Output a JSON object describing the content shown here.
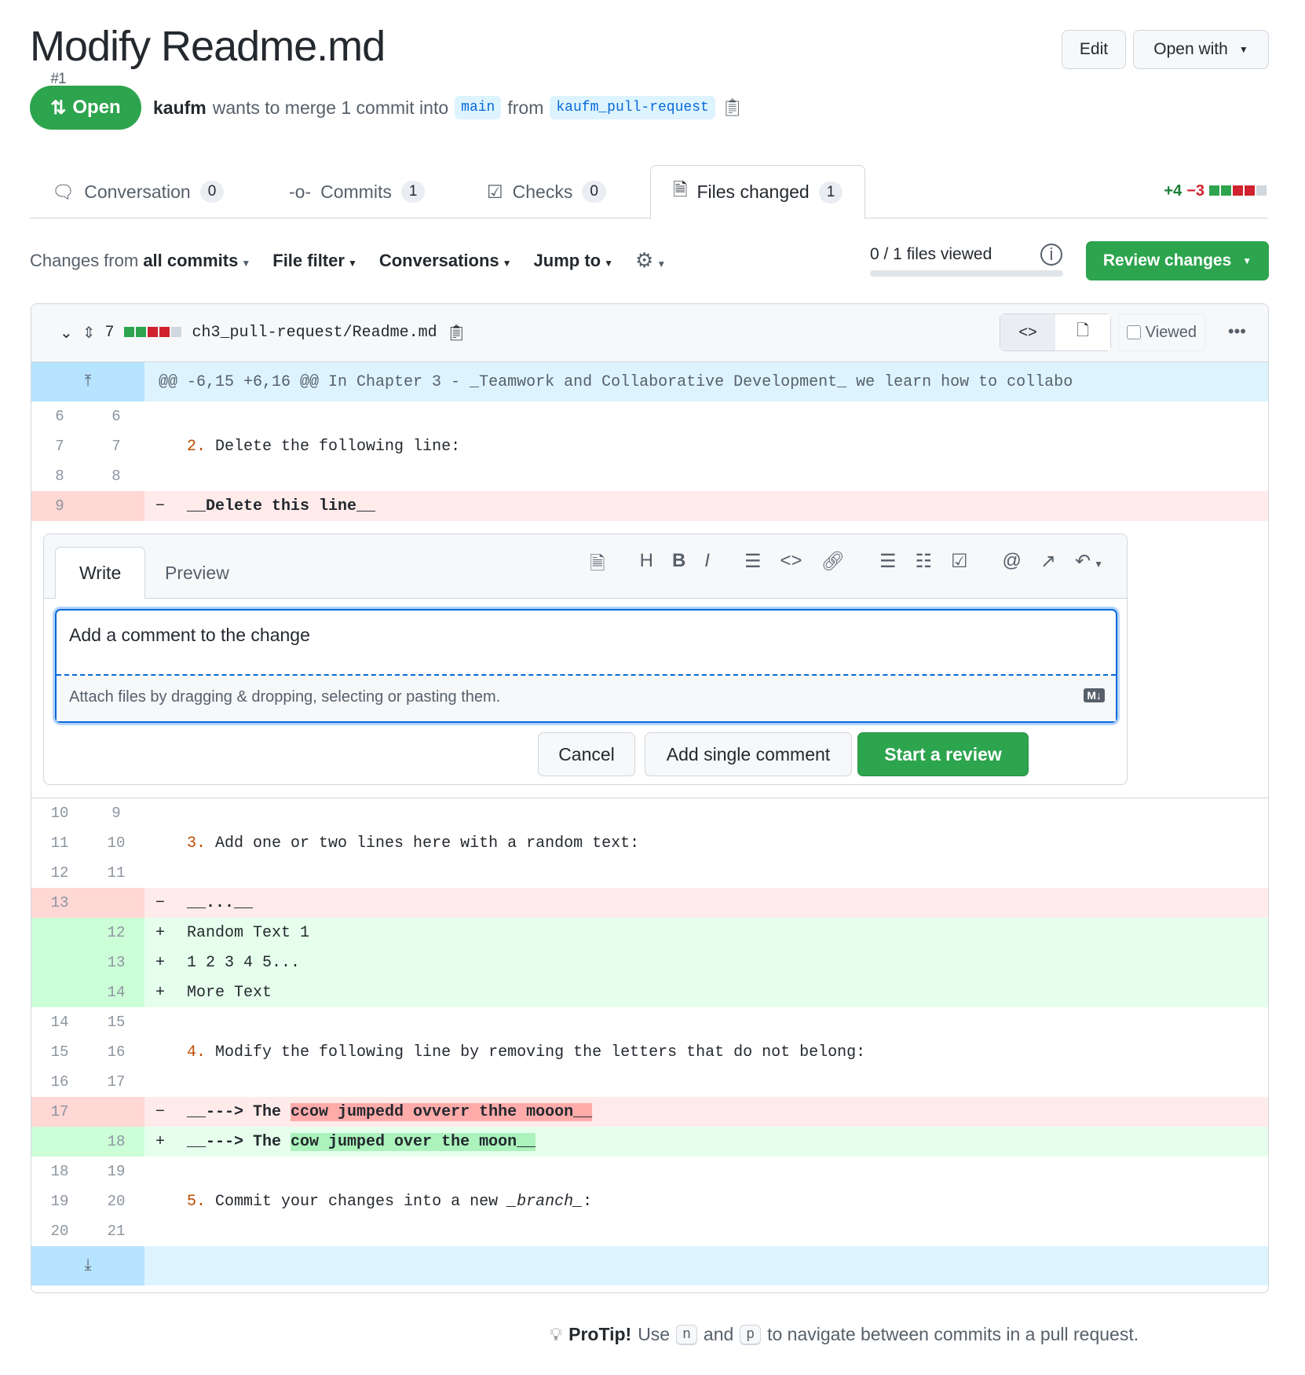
{
  "header": {
    "title": "Modify Readme.md",
    "number": "#1",
    "edit_label": "Edit",
    "open_with_label": "Open with"
  },
  "status": {
    "label": "Open",
    "author": "kaufm",
    "text_merge": "wants to merge 1 commit into",
    "base": "main",
    "text_from": "from",
    "head": "kaufm_pull-request"
  },
  "tabs": [
    {
      "label": "Conversation",
      "count": "0"
    },
    {
      "label": "Commits",
      "count": "1"
    },
    {
      "label": "Checks",
      "count": "0"
    },
    {
      "label": "Files changed",
      "count": "1"
    }
  ],
  "diffstat": {
    "additions": "+4",
    "deletions": "−3"
  },
  "toolbar": {
    "changes_prefix": "Changes from",
    "changes_value": "all commits",
    "file_filter": "File filter",
    "conversations": "Conversations",
    "jump_to": "Jump to",
    "files_viewed": "0 / 1 files viewed",
    "files_viewed_progress": 0,
    "review_changes": "Review changes"
  },
  "file": {
    "change_count": "7",
    "path": "ch3_pull-request/Readme.md",
    "viewed_label": "Viewed",
    "viewed": false
  },
  "hunk": "@@ -6,15 +6,16 @@ In Chapter 3 - _Teamwork and Collaborative Development_ we learn how to collabo",
  "rows_before": [
    {
      "old": "6",
      "new": "6",
      "type": "ctx",
      "parts": []
    },
    {
      "old": "7",
      "new": "7",
      "type": "ctx",
      "parts": [
        {
          "t": "2.",
          "s": "marker"
        },
        {
          "t": " Delete the following line:"
        }
      ]
    },
    {
      "old": "8",
      "new": "8",
      "type": "ctx",
      "parts": []
    },
    {
      "old": "9",
      "new": "",
      "type": "del",
      "parts": [
        {
          "t": "__Delete this line__",
          "s": "bold"
        }
      ]
    }
  ],
  "comment": {
    "write_tab": "Write",
    "preview_tab": "Preview",
    "value": "Add a comment to the change",
    "attach_hint": "Attach files by dragging & dropping, selecting or pasting them.",
    "cancel": "Cancel",
    "add_single": "Add single comment",
    "start_review": "Start a review"
  },
  "rows_after": [
    {
      "old": "10",
      "new": "9",
      "type": "ctx",
      "parts": []
    },
    {
      "old": "11",
      "new": "10",
      "type": "ctx",
      "parts": [
        {
          "t": "3.",
          "s": "marker"
        },
        {
          "t": " Add one or two lines here with a random text:"
        }
      ]
    },
    {
      "old": "12",
      "new": "11",
      "type": "ctx",
      "parts": []
    },
    {
      "old": "13",
      "new": "",
      "type": "del",
      "parts": [
        {
          "t": "__...__",
          "s": "bold"
        }
      ]
    },
    {
      "old": "",
      "new": "12",
      "type": "add",
      "parts": [
        {
          "t": "Random Text 1"
        }
      ]
    },
    {
      "old": "",
      "new": "13",
      "type": "add",
      "parts": [
        {
          "t": "1 2 3 4 5..."
        }
      ]
    },
    {
      "old": "",
      "new": "14",
      "type": "add",
      "parts": [
        {
          "t": "More Text"
        }
      ]
    },
    {
      "old": "14",
      "new": "15",
      "type": "ctx",
      "parts": []
    },
    {
      "old": "15",
      "new": "16",
      "type": "ctx",
      "parts": [
        {
          "t": "4.",
          "s": "marker"
        },
        {
          "t": " Modify the following line by removing the letters that do not belong:"
        }
      ]
    },
    {
      "old": "16",
      "new": "17",
      "type": "ctx",
      "parts": []
    },
    {
      "old": "17",
      "new": "",
      "type": "del",
      "parts": [
        {
          "t": "__---> The ",
          "s": "bold"
        },
        {
          "t": "ccow jumpedd ovverr thhe mooon__",
          "s": "bold hl-del"
        }
      ]
    },
    {
      "old": "",
      "new": "18",
      "type": "add",
      "parts": [
        {
          "t": "__---> The ",
          "s": "bold"
        },
        {
          "t": "cow jumped over the moon__",
          "s": "bold hl-add"
        }
      ]
    },
    {
      "old": "18",
      "new": "19",
      "type": "ctx",
      "parts": []
    },
    {
      "old": "19",
      "new": "20",
      "type": "ctx",
      "parts": [
        {
          "t": "5.",
          "s": "marker"
        },
        {
          "t": " Commit your changes into a new "
        },
        {
          "t": "_branch_",
          "s": "italic"
        },
        {
          "t": ":"
        }
      ]
    },
    {
      "old": "20",
      "new": "21",
      "type": "ctx",
      "parts": []
    }
  ],
  "protip": {
    "label": "ProTip!",
    "t1": "Use",
    "k1": "n",
    "t2": "and",
    "k2": "p",
    "t3": "to navigate between commits in a pull request."
  },
  "colors": {
    "green": "#2da44e",
    "red": "#cf222e",
    "link": "#0969da"
  }
}
